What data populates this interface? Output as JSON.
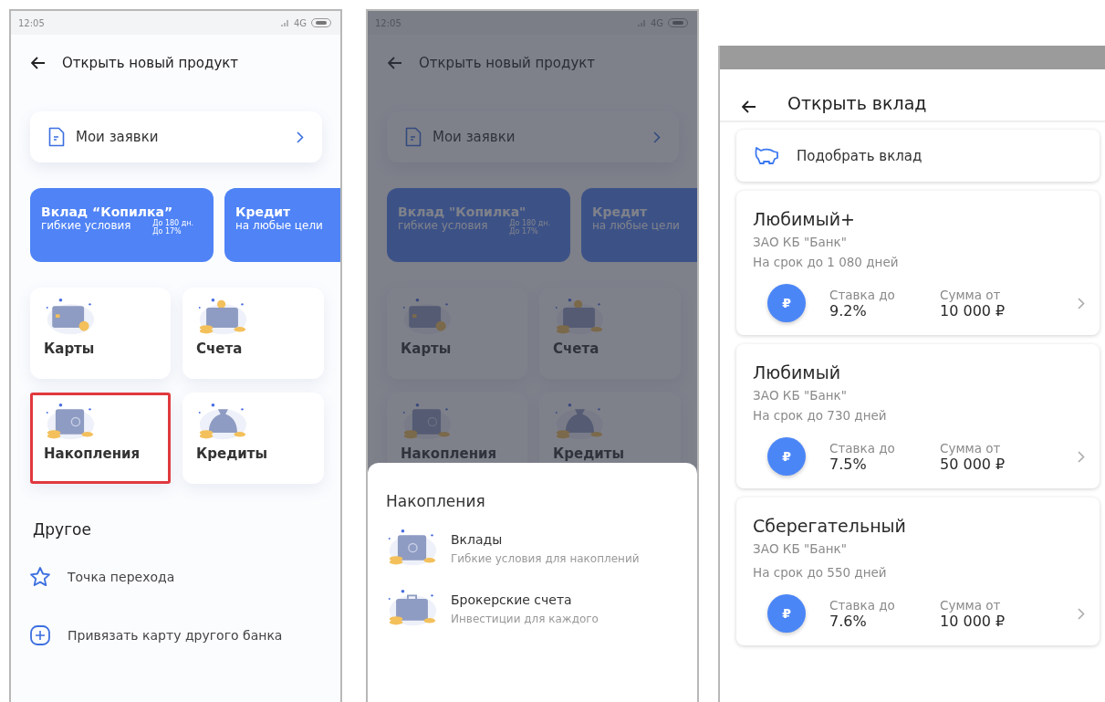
{
  "new_product_screen": {
    "status_bar": {
      "time": "12:05",
      "network": "4G"
    },
    "title": "Открыть новый продукт",
    "applications_link": "Мои заявки",
    "promos": [
      {
        "title": "Вклад “Копилка”",
        "subtitle": "гибкие условия",
        "details": [
          "До 180 дн.",
          "До 17%"
        ]
      },
      {
        "title": "Кредит",
        "subtitle": "на любые цели"
      }
    ],
    "tiles": [
      {
        "label": "Карты",
        "selected": false
      },
      {
        "label": "Счета",
        "selected": false
      },
      {
        "label": "Накопления",
        "selected": true
      },
      {
        "label": "Кредиты",
        "selected": false
      }
    ],
    "other": {
      "heading": "Другое",
      "items": [
        "Точка перехода",
        "Привязать карту другого банка"
      ]
    }
  },
  "savings_sheet_screen": {
    "background": {
      "status_bar": {
        "time": "12:05",
        "network": "4G"
      },
      "title": "Открыть новый продукт",
      "applications_link": "Мои заявки",
      "promos": [
        {
          "title": "Вклад \"Копилка\"",
          "subtitle": "гибкие условия",
          "details": [
            "До 180 дн.",
            "До 17%"
          ]
        },
        {
          "title": "Кредит",
          "subtitle": "на любые цели"
        }
      ],
      "tiles": [
        {
          "label": "Карты",
          "selected": false
        },
        {
          "label": "Счета",
          "selected": false
        },
        {
          "label": "Накопления",
          "selected": false
        },
        {
          "label": "Кредиты",
          "selected": false
        }
      ]
    },
    "sheet": {
      "title": "Накопления",
      "items": [
        {
          "title": "Вклады",
          "subtitle": "Гибкие условия для накоплений"
        },
        {
          "title": "Брокерские счета",
          "subtitle": "Инвестиции для каждого"
        }
      ]
    }
  },
  "deposit_screen": {
    "title": "Открыть вклад",
    "picker": "Подобрать вклад",
    "deposits": [
      {
        "name": "Любимый+",
        "bank": "ЗАО КБ \"Банк\"",
        "term": "На срок до 1 080 дней",
        "currency_badge": "₽",
        "rate_label": "Ставка до",
        "rate": "9.2%",
        "amount_label": "Сумма от",
        "amount": "10 000 ₽"
      },
      {
        "name": "Любимый",
        "bank": "ЗАО КБ \"Банк\"",
        "term": "На срок до 730 дней",
        "currency_badge": "₽",
        "rate_label": "Ставка до",
        "rate": "7.5%",
        "amount_label": "Сумма от",
        "amount": "50 000 ₽"
      },
      {
        "name": "Сберегательный",
        "bank": "ЗАО КБ \"Банк\"",
        "term": "На срок до 550 дней",
        "currency_badge": "₽",
        "rate_label": "Ставка до",
        "rate": "7.6%",
        "amount_label": "Сумма от",
        "amount": "10 000 ₽"
      }
    ]
  }
}
